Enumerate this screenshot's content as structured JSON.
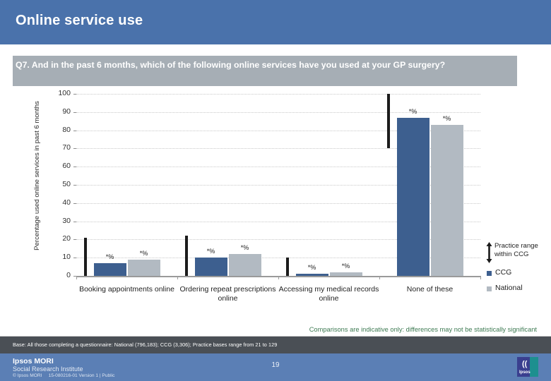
{
  "header": {
    "title": "Online service use"
  },
  "question": {
    "text": "Q7. And in the past 6 months, which of the following online services have you used at your GP surgery?"
  },
  "legend": {
    "range_label": "Practice range within CCG",
    "ccg_label": "CCG",
    "national_label": "National",
    "range_icon": "up-down-arrow-icon"
  },
  "footer": {
    "note": "Comparisons are indicative only: differences may not be statistically significant",
    "base": "Base: All those completing a questionnaire: National (796,183); CCG (3,306); Practice bases range from 21 to 129",
    "brand_name": "Ipsos MORI",
    "brand_sub": "Social Research Institute",
    "copyright": "© Ipsos MORI     15-080216-01 Version 1 | Public",
    "page_number": "19",
    "logo_mark": "((",
    "logo_word": "Ipsos"
  },
  "colors": {
    "header_blue": "#4a72ab",
    "question_gray": "#a6aeb5",
    "ccg_blue": "#3d5f8f",
    "national_gray": "#b2bac2",
    "range_black": "#1c1c1c",
    "note_green": "#3d7a52",
    "base_band": "#4a4f55",
    "brand_band": "#5b7fb5"
  },
  "chart_data": {
    "type": "bar",
    "title": "Online service use",
    "xlabel": "",
    "ylabel": "Percentage used online services in past 6 months",
    "ylim": [
      0,
      100
    ],
    "ytick_step": 10,
    "yticks": [
      "0",
      "10",
      "20",
      "30",
      "40",
      "50",
      "60",
      "70",
      "80",
      "90",
      "100"
    ],
    "grid": true,
    "legend_position": "right",
    "categories": [
      "Booking appointments online",
      "Ordering repeat prescriptions online",
      "Accessing my medical records online",
      "None of these"
    ],
    "series": [
      {
        "name": "CCG",
        "color": "#3d5f8f",
        "values": [
          7,
          10,
          1,
          87
        ]
      },
      {
        "name": "National",
        "color": "#b2bac2",
        "values": [
          9,
          12,
          2,
          83
        ]
      }
    ],
    "data_labels": {
      "CCG": [
        "*%",
        "*%",
        "*%",
        "*%"
      ],
      "National": [
        "*%",
        "*%",
        "*%",
        "*%"
      ]
    },
    "practice_range": {
      "name": "Practice range within CCG",
      "color": "#1c1c1c",
      "ranges": [
        {
          "category": "Booking appointments online",
          "min": 0,
          "max": 21
        },
        {
          "category": "Ordering repeat prescriptions online",
          "min": 0,
          "max": 22
        },
        {
          "category": "Accessing my medical records online",
          "min": 0,
          "max": 10
        },
        {
          "category": "None of these",
          "min": 70,
          "max": 100
        }
      ]
    }
  }
}
